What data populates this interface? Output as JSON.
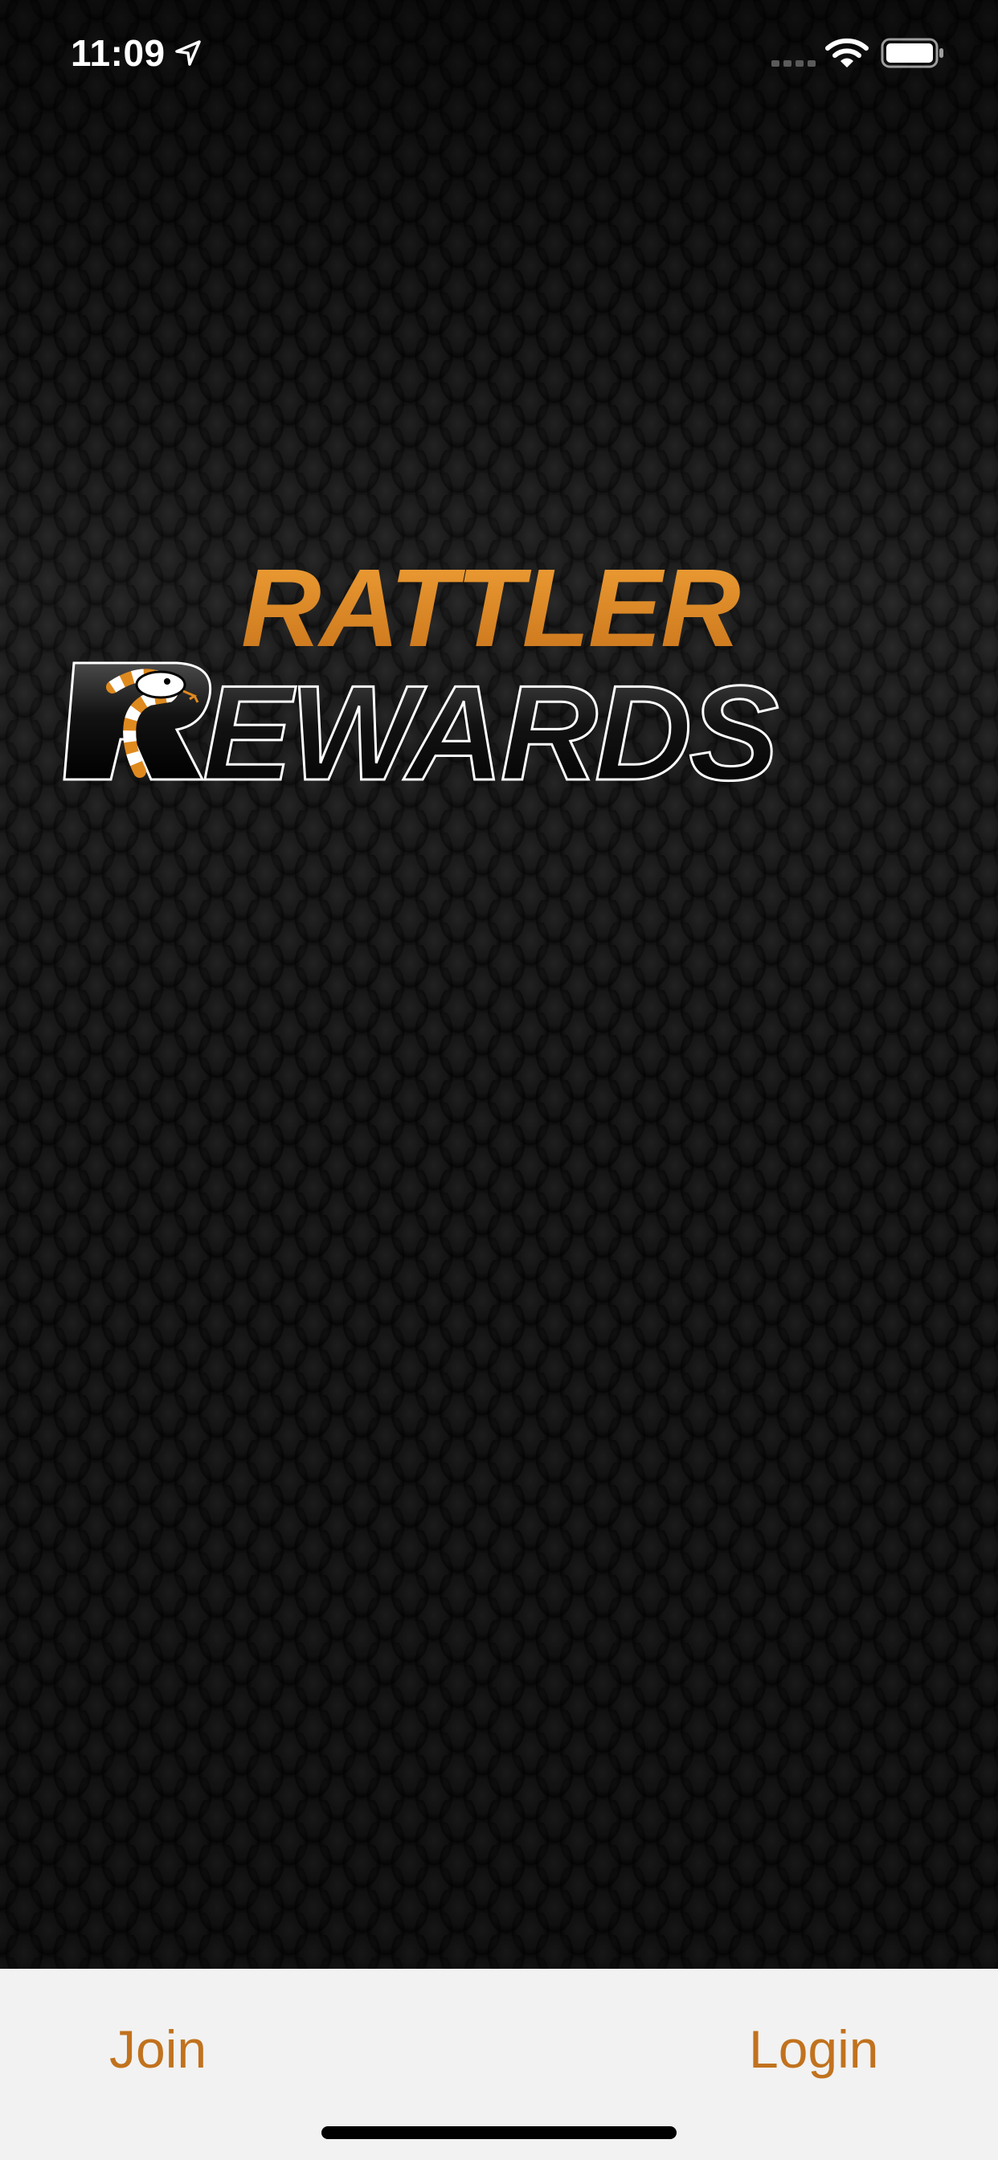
{
  "status_bar": {
    "time": "11:09",
    "icons": [
      "location-arrow-icon",
      "signal-icon",
      "wifi-icon",
      "battery-icon"
    ]
  },
  "logo": {
    "line1": "RATTLER",
    "line2": "REWARDS",
    "accent_color": "#df8a1f",
    "mark": "rattlesnake-icon"
  },
  "bottom_bar": {
    "join_label": "Join",
    "login_label": "Login",
    "text_color": "#c1721e",
    "background_color": "#f2f2f2"
  }
}
